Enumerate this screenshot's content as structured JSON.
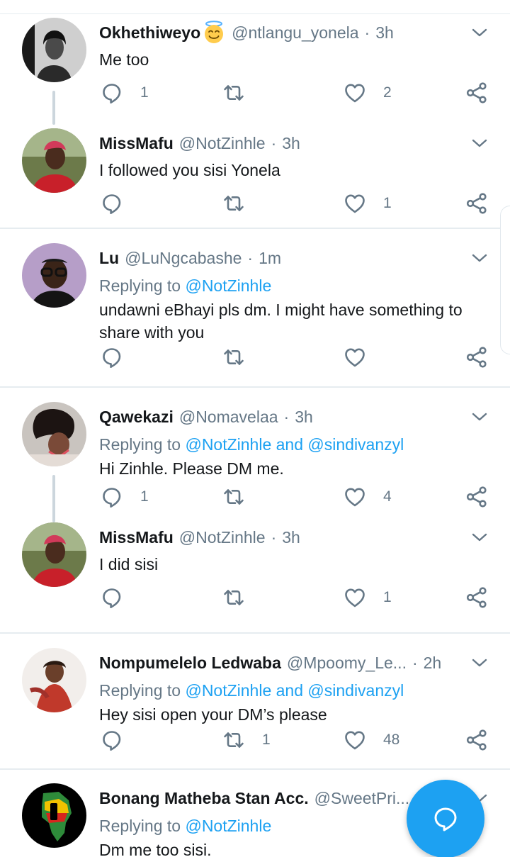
{
  "colors": {
    "link": "#1da1f2",
    "secondary_text": "#657786",
    "icon": "#657786",
    "divider": "#e6ecf0",
    "fab": "#1da1f2"
  },
  "tweets": [
    {
      "name": "Okhethiweyo",
      "name_emoji": "smiling-face-with-halo",
      "handle": "@ntlangu_yonela",
      "dot": "·",
      "time": "3h",
      "reply_prefix": "",
      "reply_targets": "",
      "text": "Me too",
      "reply_count": "1",
      "retweet_count": "",
      "like_count": "2"
    },
    {
      "name": "MissMafu",
      "handle": "@NotZinhle",
      "dot": "·",
      "time": "3h",
      "reply_prefix": "",
      "reply_targets": "",
      "text": "I followed you sisi Yonela",
      "reply_count": "",
      "retweet_count": "",
      "like_count": "1"
    },
    {
      "name": "Lu",
      "handle": "@LuNgcabashe",
      "dot": "·",
      "time": "1m",
      "reply_prefix": "Replying to ",
      "reply_targets": "@NotZinhle",
      "text": "undawni eBhayi pls dm. I might have something to share with you",
      "reply_count": "",
      "retweet_count": "",
      "like_count": ""
    },
    {
      "name": "Qawekazi",
      "handle": "@Nomavelaa",
      "dot": "·",
      "time": "3h",
      "reply_prefix": "Replying to ",
      "reply_targets": "@NotZinhle and @sindivanzyl",
      "text": "Hi Zinhle. Please DM me.",
      "reply_count": "1",
      "retweet_count": "",
      "like_count": "4"
    },
    {
      "name": "MissMafu",
      "handle": "@NotZinhle",
      "dot": "·",
      "time": "3h",
      "reply_prefix": "",
      "reply_targets": "",
      "text": "I did sisi",
      "reply_count": "",
      "retweet_count": "",
      "like_count": "1"
    },
    {
      "name": "Nompumelelo Ledwaba",
      "handle": "@Mpoomy_Le...",
      "dot": "·",
      "time": "2h",
      "reply_prefix": "Replying to ",
      "reply_targets": "@NotZinhle and @sindivanzyl",
      "text": "Hey sisi open your DM’s please",
      "reply_count": "",
      "retweet_count": "1",
      "like_count": "48"
    },
    {
      "name": "Bonang Matheba Stan Acc.",
      "handle": "@SweetPri...",
      "dot": "",
      "time": "",
      "reply_prefix": "Replying to ",
      "reply_targets": "@NotZinhle",
      "text": "Dm me too sisi.",
      "reply_count": "",
      "retweet_count": "",
      "like_count": ""
    }
  ],
  "icons": {
    "reply": "reply-icon",
    "retweet": "retweet-icon",
    "like": "heart-icon",
    "share": "share-icon",
    "more": "chevron-down-icon",
    "compose": "new-reply-icon"
  }
}
